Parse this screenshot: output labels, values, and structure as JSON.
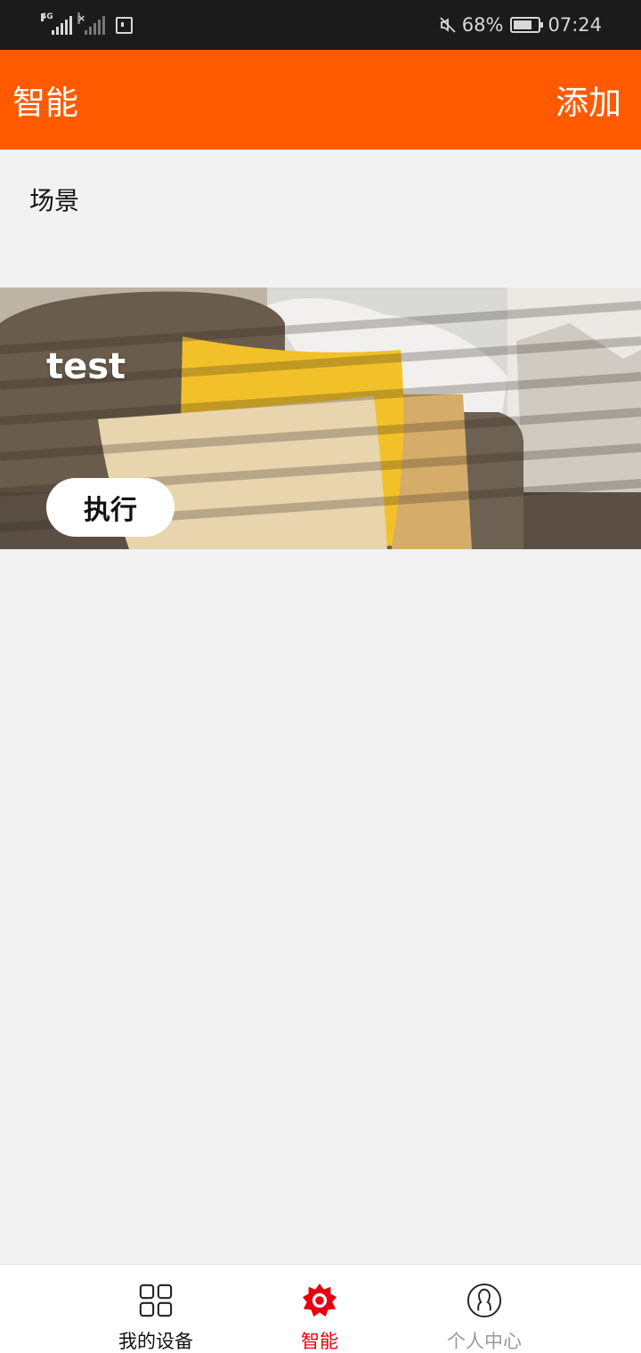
{
  "status_bar": {
    "network_tag": "4G",
    "battery_percent": "68%",
    "time": "07:24",
    "icons": [
      "signal-4g-icon",
      "signal-no-sim-icon",
      "sim-card-icon",
      "mute-icon",
      "battery-icon"
    ]
  },
  "header": {
    "title": "智能",
    "add_label": "添加",
    "accent_color": "#ff5a00"
  },
  "section": {
    "title": "场景"
  },
  "scenes": [
    {
      "name": "test",
      "run_label": "执行"
    }
  ],
  "bottom_nav": {
    "items": [
      {
        "label": "我的设备",
        "icon": "grid-icon",
        "state": "inactive"
      },
      {
        "label": "智能",
        "icon": "smart-sun-icon",
        "state": "active",
        "color": "#e60012"
      },
      {
        "label": "个人中心",
        "icon": "person-icon",
        "state": "inactive"
      }
    ]
  }
}
